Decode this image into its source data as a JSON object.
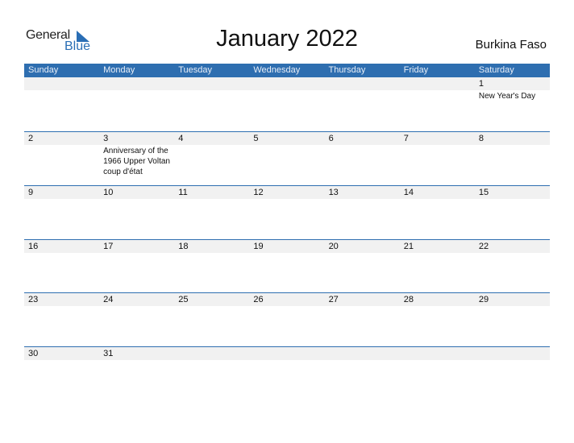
{
  "logo": {
    "line1": "General",
    "line2": "Blue",
    "accent_color": "#2a6eb5"
  },
  "title": "January 2022",
  "country": "Burkina Faso",
  "colors": {
    "header_bg": "#2e6eb0",
    "date_strip_bg": "#f1f1f1"
  },
  "weekdays": [
    "Sunday",
    "Monday",
    "Tuesday",
    "Wednesday",
    "Thursday",
    "Friday",
    "Saturday"
  ],
  "weeks": [
    [
      {
        "day": ""
      },
      {
        "day": ""
      },
      {
        "day": ""
      },
      {
        "day": ""
      },
      {
        "day": ""
      },
      {
        "day": ""
      },
      {
        "day": "1",
        "holiday": "New Year's Day"
      }
    ],
    [
      {
        "day": "2"
      },
      {
        "day": "3",
        "holiday": "Anniversary of the 1966 Upper Voltan coup d'état"
      },
      {
        "day": "4"
      },
      {
        "day": "5"
      },
      {
        "day": "6"
      },
      {
        "day": "7"
      },
      {
        "day": "8"
      }
    ],
    [
      {
        "day": "9"
      },
      {
        "day": "10"
      },
      {
        "day": "11"
      },
      {
        "day": "12"
      },
      {
        "day": "13"
      },
      {
        "day": "14"
      },
      {
        "day": "15"
      }
    ],
    [
      {
        "day": "16"
      },
      {
        "day": "17"
      },
      {
        "day": "18"
      },
      {
        "day": "19"
      },
      {
        "day": "20"
      },
      {
        "day": "21"
      },
      {
        "day": "22"
      }
    ],
    [
      {
        "day": "23"
      },
      {
        "day": "24"
      },
      {
        "day": "25"
      },
      {
        "day": "26"
      },
      {
        "day": "27"
      },
      {
        "day": "28"
      },
      {
        "day": "29"
      }
    ],
    [
      {
        "day": "30"
      },
      {
        "day": "31"
      },
      {
        "day": ""
      },
      {
        "day": ""
      },
      {
        "day": ""
      },
      {
        "day": ""
      },
      {
        "day": ""
      }
    ]
  ]
}
